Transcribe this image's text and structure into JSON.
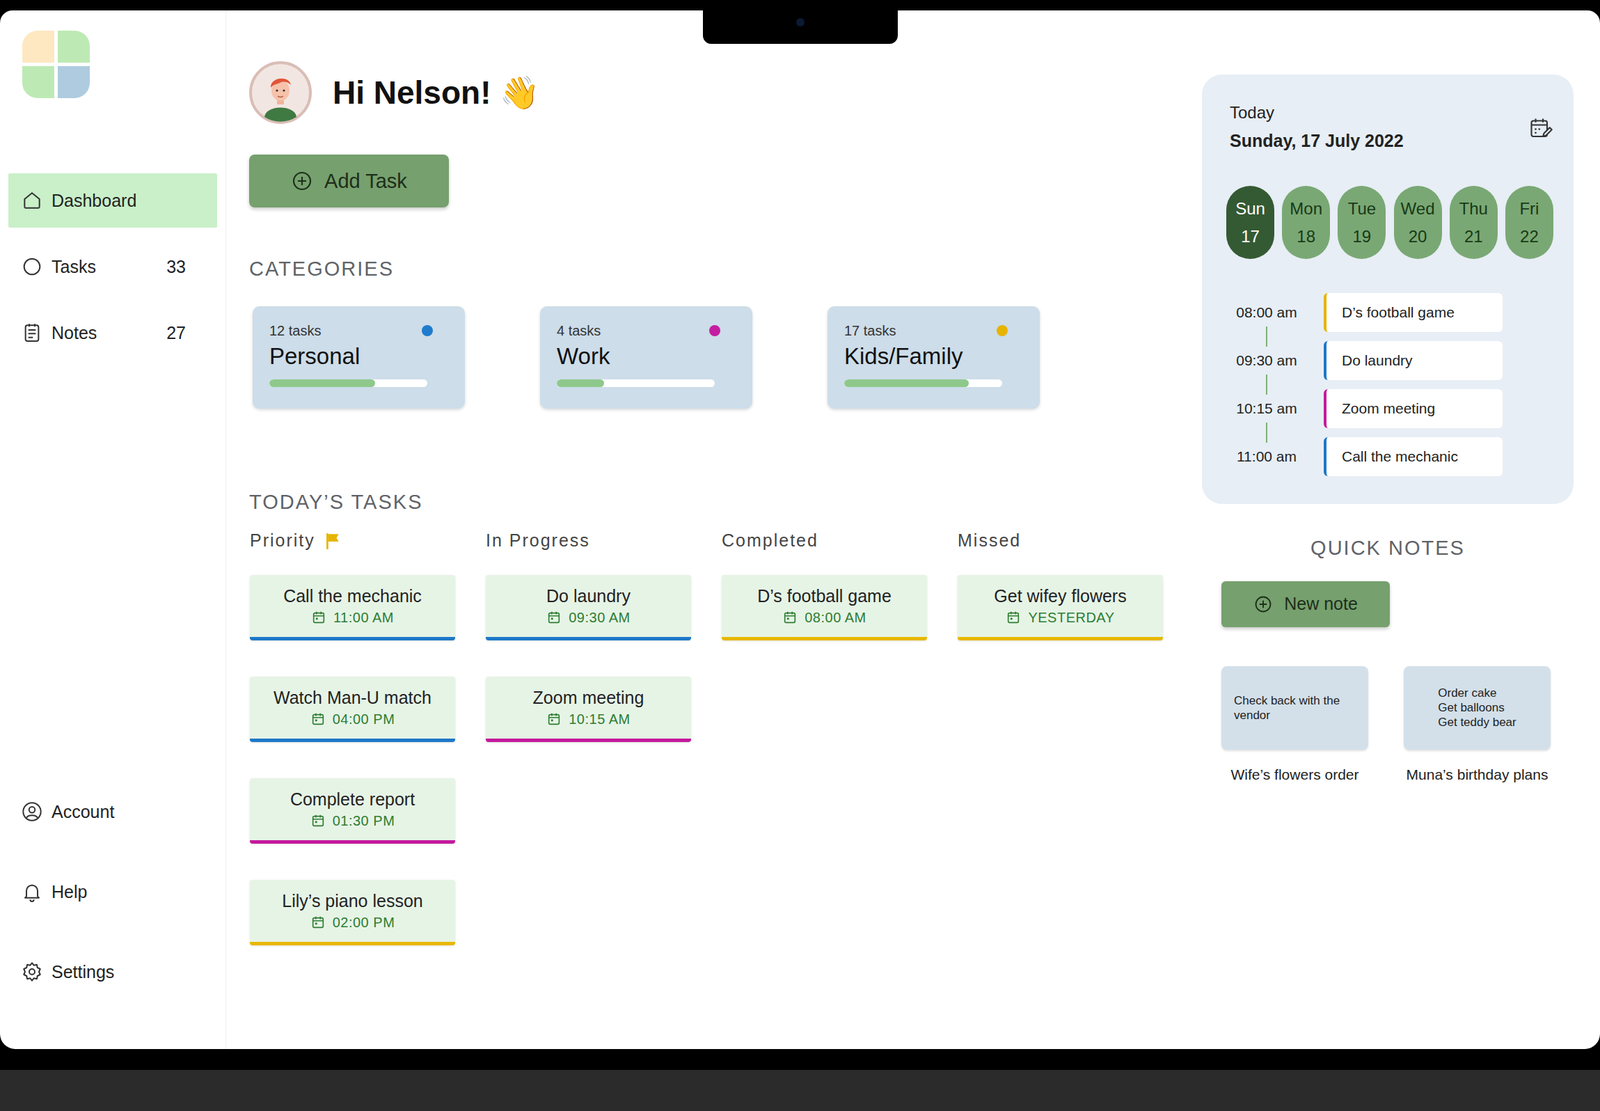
{
  "sidebar": {
    "items": [
      {
        "label": "Dashboard",
        "selected": true
      },
      {
        "label": "Tasks",
        "count": "33",
        "selected": false
      },
      {
        "label": "Notes",
        "count": "27",
        "selected": false
      }
    ],
    "footer_items": [
      {
        "label": "Account"
      },
      {
        "label": "Help"
      },
      {
        "label": "Settings"
      }
    ]
  },
  "header": {
    "greeting": "Hi Nelson!",
    "emoji": "👋"
  },
  "add_task_button": "Add Task",
  "categories": {
    "title": "CATEGORIES",
    "items": [
      {
        "count": "12 tasks",
        "name": "Personal",
        "level": 0.67,
        "color": "#1f7ccc"
      },
      {
        "count": "4 tasks",
        "name": "Work",
        "level": 0.3,
        "color": "#c41ea0"
      },
      {
        "count": "17 tasks",
        "name": "Kids/Family",
        "level": 0.79,
        "color": "#e6b400"
      }
    ]
  },
  "todays_tasks": {
    "title": "TODAY’S TASKS",
    "columns": [
      {
        "title": "Priority",
        "flag": true,
        "tasks": [
          {
            "title": "Call the mechanic",
            "time": "11:00 AM",
            "color": "#1e78c8"
          },
          {
            "title": "Watch Man-U match",
            "time": "04:00 PM",
            "color": "#1e78c8"
          },
          {
            "title": "Complete report",
            "time": "01:30 PM",
            "color": "#c41a9c"
          },
          {
            "title": "Lily’s piano lesson",
            "time": "02:00 PM",
            "color": "#e8b800"
          }
        ]
      },
      {
        "title": "In Progress",
        "flag": false,
        "tasks": [
          {
            "title": "Do laundry",
            "time": "09:30 AM",
            "color": "#1e78c8"
          },
          {
            "title": "Zoom meeting",
            "time": "10:15 AM",
            "color": "#c41a9c"
          }
        ]
      },
      {
        "title": "Completed",
        "flag": false,
        "tasks": [
          {
            "title": "D’s football game",
            "time": "08:00 AM",
            "color": "#e8b800"
          }
        ]
      },
      {
        "title": "Missed",
        "flag": false,
        "tasks": [
          {
            "title": "Get wifey flowers",
            "time": "YESTERDAY",
            "color": "#e8b800"
          }
        ]
      }
    ]
  },
  "calendar": {
    "label": "Today",
    "date": "Sunday, 17 July 2022",
    "days": [
      {
        "day": "Sun",
        "date": "17",
        "selected": true
      },
      {
        "day": "Mon",
        "date": "18",
        "selected": false
      },
      {
        "day": "Tue",
        "date": "19",
        "selected": false
      },
      {
        "day": "Wed",
        "date": "20",
        "selected": false
      },
      {
        "day": "Thu",
        "date": "21",
        "selected": false
      },
      {
        "day": "Fri",
        "date": "22",
        "selected": false
      }
    ],
    "schedule": [
      {
        "time": "08:00 am",
        "title": "D’s football game",
        "color": "#e6b400"
      },
      {
        "time": "09:30 am",
        "title": "Do laundry",
        "color": "#1e78c8"
      },
      {
        "time": "10:15 am",
        "title": "Zoom meeting",
        "color": "#c41a9c"
      },
      {
        "time": "11:00 am",
        "title": "Call the mechanic",
        "color": "#1e78c8"
      }
    ]
  },
  "quick_notes": {
    "title": "QUICK NOTES",
    "button": "New note",
    "notes": [
      {
        "lines": [
          "Check back with the vendor"
        ],
        "caption": "Wife’s flowers order"
      },
      {
        "lines": [
          "Order cake",
          "Get balloons",
          "Get teddy bear"
        ],
        "caption": "Muna’s birthday plans"
      }
    ]
  }
}
